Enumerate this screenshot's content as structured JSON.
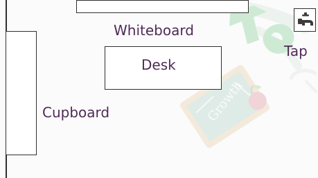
{
  "labels": {
    "whiteboard": "Whiteboard",
    "desk": "Desk",
    "tap": "Tap",
    "cupboard": "Cupboard"
  },
  "watermark": {
    "chalkboard_text": "Growth"
  },
  "colors": {
    "label_text": "#4f2b57",
    "outline": "#2f2f2f",
    "tap_icon": "#3e3a3b",
    "watermark_green": "#35b04a",
    "watermark_board": "#7fb49a",
    "watermark_frame": "#d8b26a",
    "watermark_apple": "#cf4c56"
  }
}
